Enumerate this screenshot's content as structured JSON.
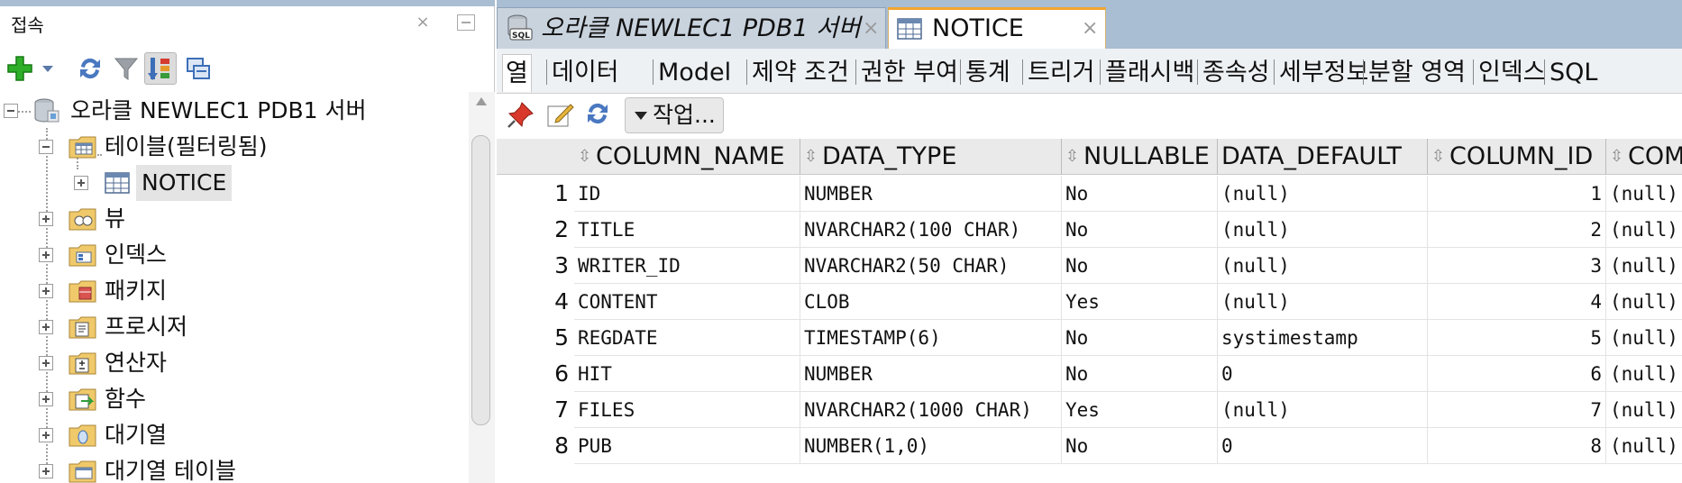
{
  "left_panel": {
    "title": "접속",
    "close_glyph": "×"
  },
  "tree": [
    {
      "label": "오라클 NEWLEC1 PDB1 서버",
      "icon": "database-connection-icon",
      "state": "expanded"
    },
    {
      "label": "테이블(필터링됨)",
      "icon": "tables-folder-icon",
      "state": "expanded"
    },
    {
      "label": "NOTICE",
      "icon": "table-icon",
      "state": "collapsed",
      "selected": true
    },
    {
      "label": "뷰",
      "icon": "views-folder-icon",
      "state": "collapsed"
    },
    {
      "label": "인덱스",
      "icon": "indexes-folder-icon",
      "state": "collapsed"
    },
    {
      "label": "패키지",
      "icon": "packages-folder-icon",
      "state": "collapsed"
    },
    {
      "label": "프로시저",
      "icon": "procedures-folder-icon",
      "state": "collapsed"
    },
    {
      "label": "연산자",
      "icon": "operators-folder-icon",
      "state": "collapsed"
    },
    {
      "label": "함수",
      "icon": "functions-folder-icon",
      "state": "collapsed"
    },
    {
      "label": "대기열",
      "icon": "queues-folder-icon",
      "state": "collapsed"
    },
    {
      "label": "대기열 테이블",
      "icon": "queue-tables-folder-icon",
      "state": "collapsed"
    }
  ],
  "tabs": {
    "connection": {
      "label": "오라클 NEWLEC1 PDB1 서버",
      "close_glyph": "×"
    },
    "notice": {
      "label": "NOTICE",
      "close_glyph": "×"
    }
  },
  "subtabs": [
    "열",
    "데이터",
    "Model",
    "제약 조건",
    "권한 부여",
    "통계",
    "트리거",
    "플래시백",
    "종속성",
    "세부정보",
    "분할 영역",
    "인덱스",
    "SQL"
  ],
  "grid_toolbar": {
    "actions_label": "작업..."
  },
  "grid": {
    "columns": [
      "COLUMN_NAME",
      "DATA_TYPE",
      "NULLABLE",
      "DATA_DEFAULT",
      "COLUMN_ID",
      "COM"
    ],
    "sort_glyph": "⇳",
    "rows": [
      {
        "num": "1",
        "cells": [
          "ID",
          "NUMBER",
          "No",
          "(null)",
          "1",
          "(null)"
        ]
      },
      {
        "num": "2",
        "cells": [
          "TITLE",
          "NVARCHAR2(100 CHAR)",
          "No",
          "(null)",
          "2",
          "(null)"
        ]
      },
      {
        "num": "3",
        "cells": [
          "WRITER_ID",
          "NVARCHAR2(50 CHAR)",
          "No",
          "(null)",
          "3",
          "(null)"
        ]
      },
      {
        "num": "4",
        "cells": [
          "CONTENT",
          "CLOB",
          "Yes",
          "(null)",
          "4",
          "(null)"
        ]
      },
      {
        "num": "5",
        "cells": [
          "REGDATE",
          "TIMESTAMP(6)",
          "No",
          "systimestamp",
          "5",
          "(null)"
        ]
      },
      {
        "num": "6",
        "cells": [
          "HIT",
          "NUMBER",
          "No",
          "0",
          "6",
          "(null)"
        ]
      },
      {
        "num": "7",
        "cells": [
          "FILES",
          "NVARCHAR2(1000 CHAR)",
          "Yes",
          "(null)",
          "7",
          "(null)"
        ]
      },
      {
        "num": "8",
        "cells": [
          "PUB",
          "NUMBER(1,0)",
          "No",
          "0",
          "8",
          "(null)"
        ]
      }
    ]
  },
  "colors": {
    "tab_strip": "#a9bdd3",
    "active_tab_accent": "#f2a531",
    "selection": "#e4e4e4"
  }
}
